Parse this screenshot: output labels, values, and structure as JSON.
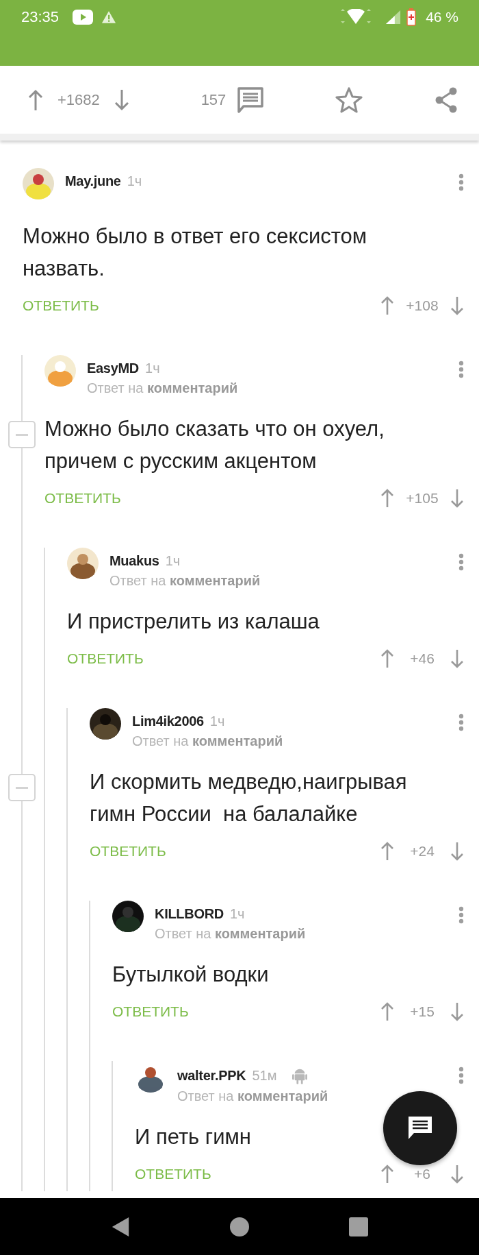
{
  "status_bar": {
    "time": "23:35",
    "battery": "46 %"
  },
  "post_actions": {
    "rating": "+1682",
    "comments": "157"
  },
  "comments": [
    {
      "author": "May.june",
      "time": "1ч",
      "android": false,
      "collapsible": false,
      "text": "Можно было в ответ его сексистом назвать.",
      "reply_label": "ОТВЕТИТЬ",
      "rating": "+108",
      "children": [
        {
          "author": "EasyMD",
          "time": "1ч",
          "android": false,
          "collapsible": true,
          "reply_to": "Ответ на **комментарий**",
          "text": "Можно было сказать что он охуел, причем с русским акцентом",
          "reply_label": "ОТВЕТИТЬ",
          "rating": "+105",
          "children": [
            {
              "author": "Muakus",
              "time": "1ч",
              "android": false,
              "collapsible": false,
              "reply_to": "Ответ на **комментарий**",
              "text": "И пристрелить из калаша",
              "reply_label": "ОТВЕТИТЬ",
              "rating": "+46",
              "children": [
                {
                  "author": "Lim4ik2006",
                  "time": "1ч",
                  "android": false,
                  "collapsible": true,
                  "reply_to": "Ответ на **комментарий**",
                  "text": "И скормить медведю,наигрывая гимн России  на балалайке",
                  "reply_label": "ОТВЕТИТЬ",
                  "rating": "+24",
                  "children": [
                    {
                      "author": "KILLBORD",
                      "time": "1ч",
                      "android": false,
                      "collapsible": false,
                      "reply_to": "Ответ на **комментарий**",
                      "text": "Бутылкой водки",
                      "reply_label": "ОТВЕТИТЬ",
                      "rating": "+15",
                      "children": [
                        {
                          "author": "walter.PPK",
                          "time": "51м",
                          "android": true,
                          "collapsible": false,
                          "reply_to": "Ответ на **комментарий**",
                          "text": "И петь гимн",
                          "reply_label": "ОТВЕТИТЬ",
                          "rating": "+6"
                        }
                      ]
                    }
                  ]
                }
              ]
            }
          ]
        }
      ]
    }
  ]
}
